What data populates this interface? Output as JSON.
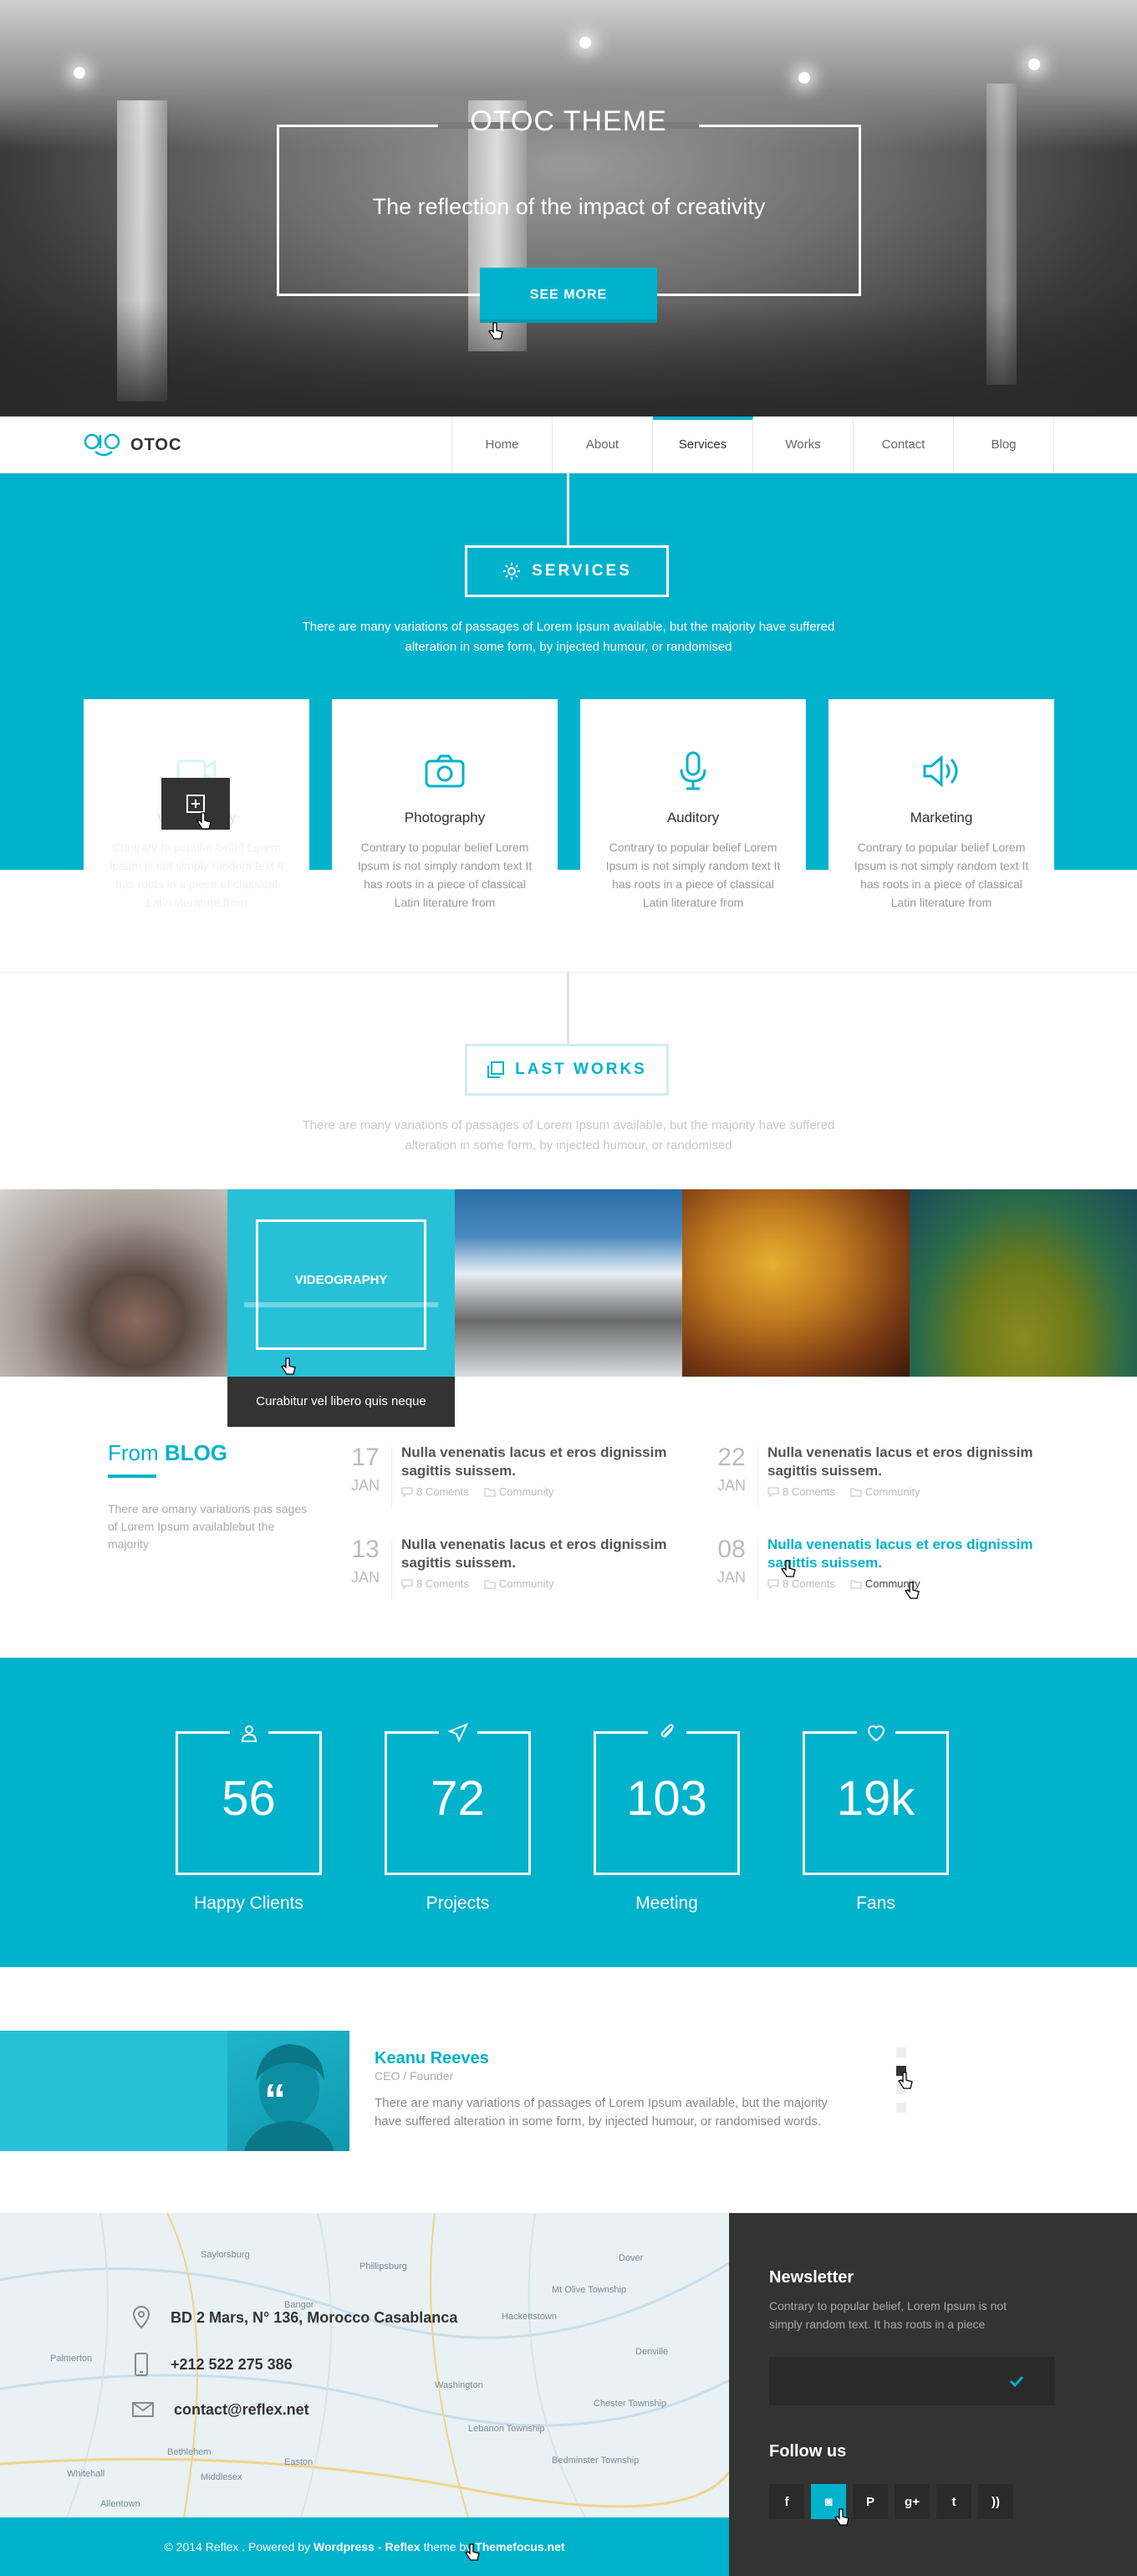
{
  "hero": {
    "title": "OTOC THEME",
    "subtitle": "The reflection of the impact of creativity",
    "cta_label": "SEE MORE"
  },
  "nav": {
    "logo_text": "OTOC",
    "items": [
      "Home",
      "About",
      "Services",
      "Works",
      "Contact",
      "Blog"
    ],
    "active_index": 2
  },
  "services": {
    "heading": "SERVICES",
    "description": "There are many variations of passages of Lorem Ipsum available, but the majority have suffered alteration in some form, by injected humour, or randomised",
    "cards": [
      {
        "icon": "video-camera-icon",
        "title": "Videography",
        "text": "Contrary to popular belief Lorem Ipsum is not simply random text It has roots in a piece of classical Latin literature from"
      },
      {
        "icon": "camera-icon",
        "title": "Photography",
        "text": "Contrary to popular belief Lorem Ipsum is not simply random text It has roots in a piece of classical Latin literature from"
      },
      {
        "icon": "microphone-icon",
        "title": "Auditory",
        "text": "Contrary to popular belief Lorem Ipsum is not simply random text It has roots in a piece of classical Latin literature from"
      },
      {
        "icon": "speaker-icon",
        "title": "Marketing",
        "text": "Contrary to popular belief Lorem Ipsum is not simply random text It has roots in a piece of classical Latin literature from"
      }
    ]
  },
  "works": {
    "heading": "LAST WORKS",
    "description": "There are many variations of passages of Lorem Ipsum available, but the majority have suffered alteration in some form, by injected humour, or randomised",
    "hover_label": "VIDEOGRAPHY",
    "hover_caption": "Curabitur vel libero quis neque"
  },
  "blog": {
    "from_label": "From",
    "blog_label": "BLOG",
    "description": "There are omany variations pas sages of Lorem Ipsum availablebut the majority",
    "posts": [
      {
        "day": "17",
        "month": "JAN",
        "title": "Nulla venenatis lacus et eros dignissim sagittis suissem.",
        "comments": "8 Coments",
        "category": "Community"
      },
      {
        "day": "22",
        "month": "JAN",
        "title": "Nulla venenatis lacus et eros dignissim sagittis suissem.",
        "comments": "8 Coments",
        "category": "Community"
      },
      {
        "day": "13",
        "month": "JAN",
        "title": "Nulla venenatis lacus et eros dignissim sagittis suissem.",
        "comments": "8 Coments",
        "category": "Community"
      },
      {
        "day": "08",
        "month": "JAN",
        "title": "Nulla venenatis lacus et eros dignissim sagittis suissem.",
        "comments": "8 Coments",
        "category": "Community"
      }
    ]
  },
  "stats": [
    {
      "icon": "user-icon",
      "value": "56",
      "label": "Happy Clients"
    },
    {
      "icon": "send-icon",
      "value": "72",
      "label": "Projects"
    },
    {
      "icon": "paperclip-icon",
      "value": "103",
      "label": "Meeting"
    },
    {
      "icon": "heart-icon",
      "value": "19k",
      "label": "Fans"
    }
  ],
  "testimonial": {
    "name": "Keanu Reeves",
    "role": "CEO / Founder",
    "text": "There are many variations of passages of Lorem Ipsum available, but the majority have suffered alteration in some form, by injected humour, or randomised words.",
    "active_dot": 1
  },
  "contact": {
    "address": "BD 2 Mars, N° 136, Morocco Casablanca",
    "phone": "+212 522 275 386",
    "email": "contact@reflex.net"
  },
  "newsletter": {
    "title": "Newsletter",
    "description": "Contrary to popular belief, Lorem Ipsum is not simply random text. It has roots in a piece",
    "input_placeholder": "",
    "follow_title": "Follow us",
    "socials": [
      "facebook-icon",
      "instagram-icon",
      "pinterest-icon",
      "google-plus-icon",
      "twitter-icon",
      "rss-icon"
    ],
    "active_social": 1
  },
  "footer": {
    "copyright": "© 2014 Reflex . Powered by",
    "wordpress": "Wordpress",
    "sep": "-",
    "reflex": "Reflex",
    "theme_by": "theme by",
    "themefocus": "Themefocus.net"
  },
  "map_labels": [
    "Saylorsburg",
    "Bangor",
    "Palmerton",
    "Hackettstown",
    "Mt Olive Township",
    "Denville",
    "Washington",
    "Chester Township",
    "Lebanon Township",
    "Bethlehem",
    "Allentown",
    "Easton",
    "Bedminster Township",
    "Whitehall",
    "Middlesex",
    "Dover",
    "Phillipsburg"
  ],
  "colors": {
    "accent": "#00b2cc",
    "dark": "#333333"
  }
}
